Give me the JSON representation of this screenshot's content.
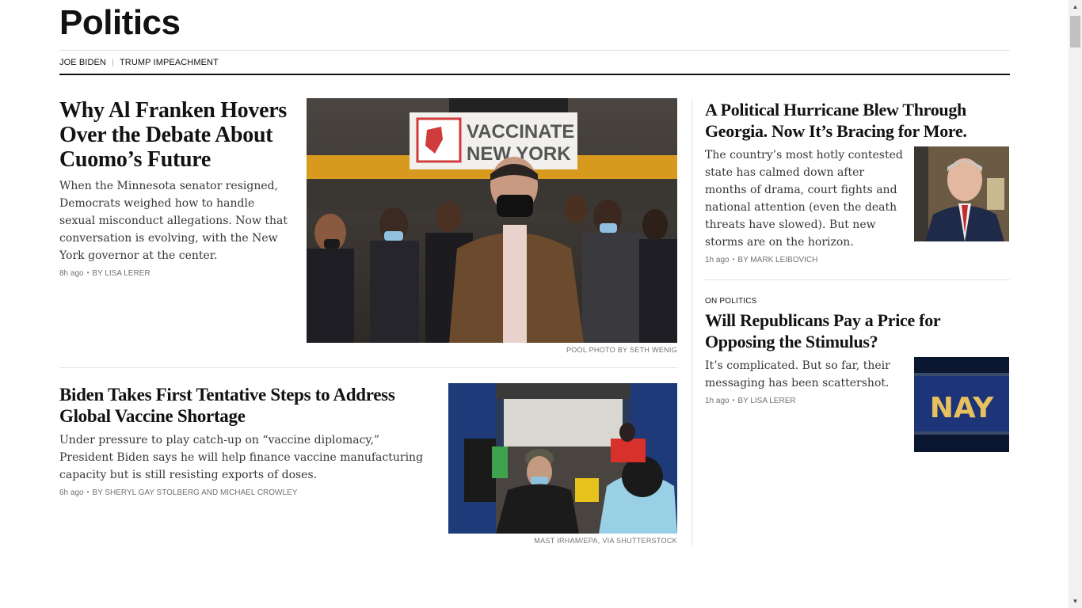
{
  "section": {
    "title": "Politics"
  },
  "subnav": {
    "items": [
      "JOE BIDEN",
      "TRUMP IMPEACHMENT"
    ]
  },
  "stories": {
    "franken": {
      "headline": "Why Al Franken Hovers Over the Debate About Cuomo’s Future",
      "summary": "When the Minnesota senator resigned, Democrats weighed how to handle sexual misconduct allegations. Now that conversation is evolving, with the New York governor at the center.",
      "time": "8h ago",
      "byline": "By LISA LERER",
      "image_credit": "POOL PHOTO BY SETH WENIG",
      "image_sign_line1": "VACCINATE",
      "image_sign_line2": "NEW YORK"
    },
    "biden": {
      "headline": "Biden Takes First Tentative Steps to Address Global Vaccine Shortage",
      "summary": "Under pressure to play catch-up on “vaccine diplomacy,” President Biden says he will help finance vaccine manufacturing capacity but is still resisting exports of doses.",
      "time": "6h ago",
      "byline": "By SHERYL GAY STOLBERG and MICHAEL CROWLEY",
      "image_credit": "MAST IRHAM/EPA, VIA SHUTTERSTOCK"
    },
    "georgia": {
      "headline": "A Political Hurricane Blew Through Georgia. Now It’s Bracing for More.",
      "summary": "The country’s most hotly contested state has calmed down after months of drama, court fights and national attention (even the death threats have slowed). But new storms are on the horizon.",
      "time": "1h ago",
      "byline": "By MARK LEIBOVICH"
    },
    "republicans": {
      "kicker": "ON POLITICS",
      "headline": "Will Republicans Pay a Price for Opposing the Stimulus?",
      "summary": "It’s complicated. But so far, their messaging has been scattershot.",
      "time": "1h ago",
      "byline": "By LISA LERER",
      "image_text": "NAY"
    }
  },
  "colors": {
    "text": "#121212",
    "meta": "#727272",
    "rule": "#e2e2e2"
  }
}
